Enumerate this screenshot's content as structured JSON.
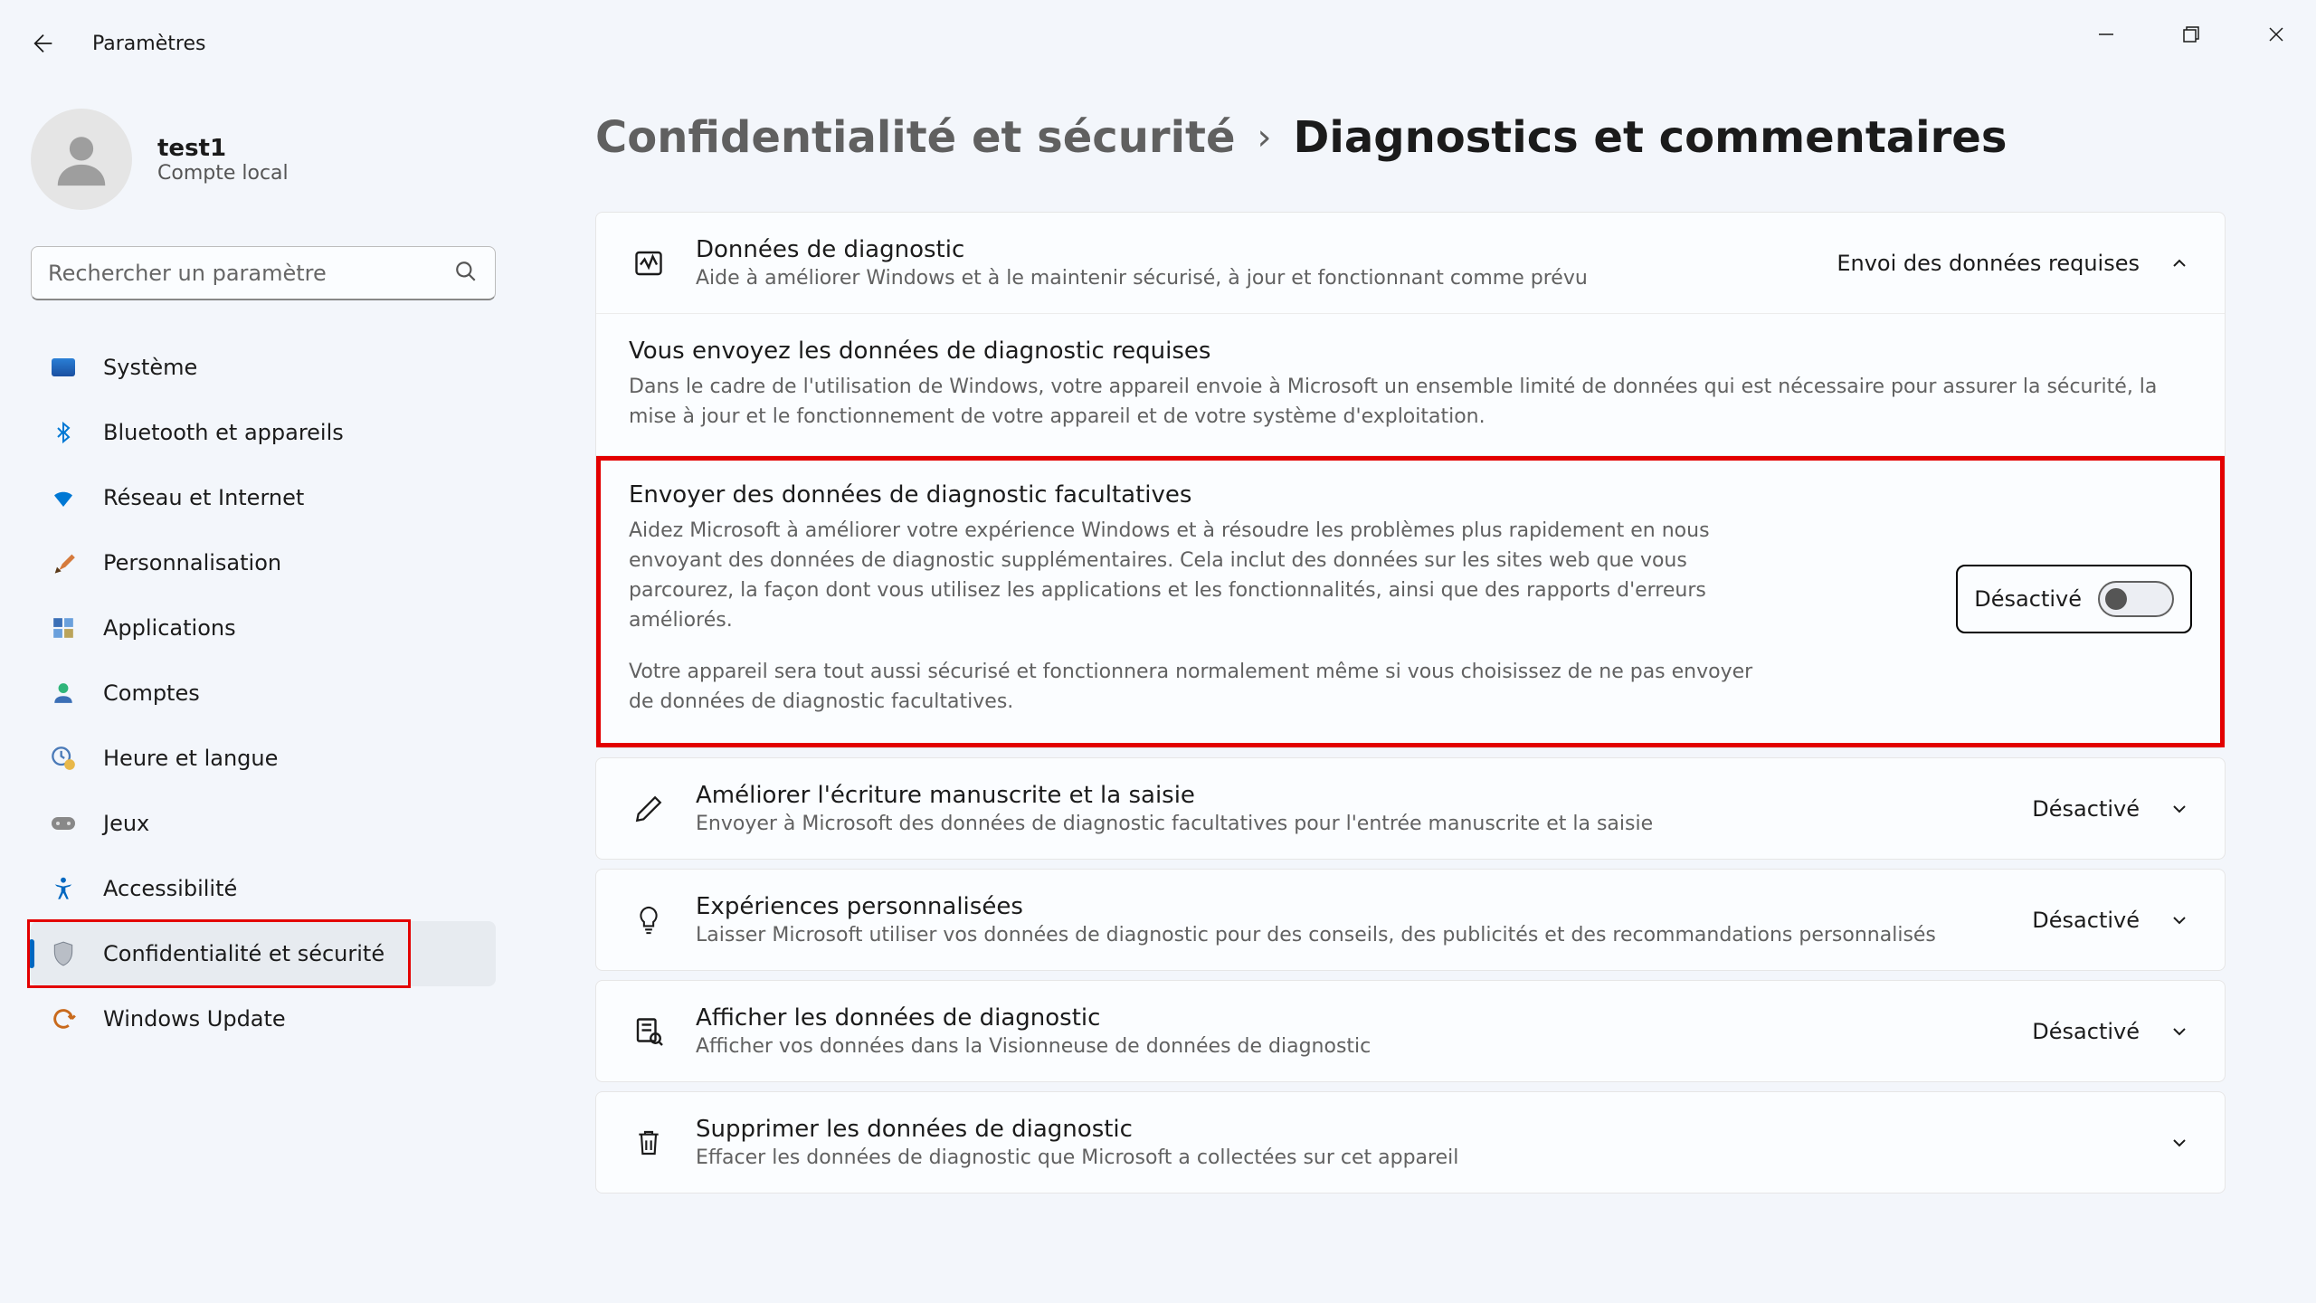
{
  "window": {
    "app_title": "Paramètres"
  },
  "user": {
    "name": "test1",
    "account_type": "Compte local"
  },
  "search": {
    "placeholder": "Rechercher un paramètre"
  },
  "nav": {
    "items": [
      {
        "label": "Système"
      },
      {
        "label": "Bluetooth et appareils"
      },
      {
        "label": "Réseau et Internet"
      },
      {
        "label": "Personnalisation"
      },
      {
        "label": "Applications"
      },
      {
        "label": "Comptes"
      },
      {
        "label": "Heure et langue"
      },
      {
        "label": "Jeux"
      },
      {
        "label": "Accessibilité"
      },
      {
        "label": "Confidentialité et sécurité"
      },
      {
        "label": "Windows Update"
      }
    ]
  },
  "breadcrumb": {
    "parent": "Confidentialité et sécurité",
    "current": "Diagnostics et commentaires"
  },
  "main": {
    "diag": {
      "title": "Données de diagnostic",
      "subtitle": "Aide à améliorer Windows et à le maintenir sécurisé, à jour et fonctionnant comme prévu",
      "status": "Envoi des données requises",
      "required": {
        "title": "Vous envoyez les données de diagnostic requises",
        "desc": "Dans le cadre de l'utilisation de Windows, votre appareil envoie à Microsoft un ensemble limité de données qui est nécessaire pour assurer la sécurité, la mise à jour et le fonctionnement de votre appareil et de votre système d'exploitation."
      },
      "optional": {
        "title": "Envoyer des données de diagnostic facultatives",
        "desc1": "Aidez Microsoft à améliorer votre expérience Windows et à résoudre les problèmes plus rapidement en nous envoyant des données de diagnostic supplémentaires. Cela inclut des données sur les sites web que vous parcourez, la façon dont vous utilisez les applications et les fonctionnalités, ainsi que des rapports d'erreurs améliorés.",
        "desc2": "Votre appareil sera tout aussi sécurisé et fonctionnera normalement même si vous choisissez de ne pas envoyer de données de diagnostic facultatives.",
        "toggle_label": "Désactivé"
      }
    },
    "ink": {
      "title": "Améliorer l'écriture manuscrite et la saisie",
      "subtitle": "Envoyer à Microsoft des données de diagnostic facultatives pour l'entrée manuscrite et la saisie",
      "status": "Désactivé"
    },
    "tailored": {
      "title": "Expériences personnalisées",
      "subtitle": "Laisser Microsoft utiliser vos données de diagnostic pour des conseils, des publicités et des recommandations personnalisés",
      "status": "Désactivé"
    },
    "view": {
      "title": "Afficher les données de diagnostic",
      "subtitle": "Afficher vos données dans la Visionneuse de données de diagnostic",
      "status": "Désactivé"
    },
    "delete": {
      "title": "Supprimer les données de diagnostic",
      "subtitle": "Effacer les données de diagnostic que Microsoft a collectées sur cet appareil"
    }
  }
}
